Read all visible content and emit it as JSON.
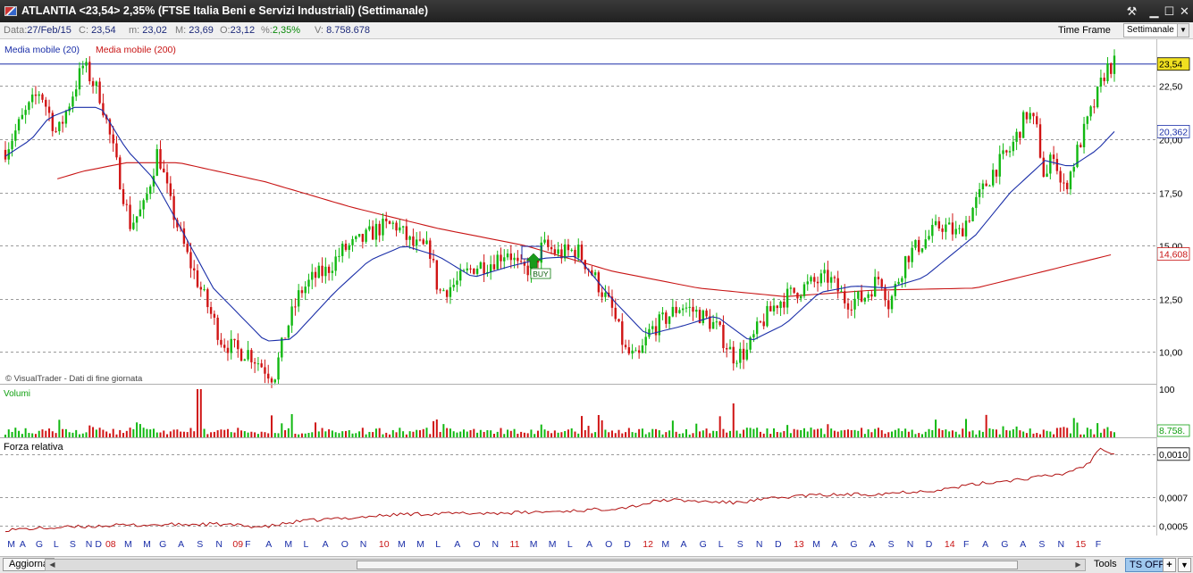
{
  "window": {
    "title": "ATLANTIA <23,54> 2,35%  (FTSE Italia Beni e Servizi Industriali)  (Settimanale)"
  },
  "info": {
    "date_label": "Data:",
    "date": "27/Feb/15",
    "close_label": "C:",
    "close": "23,54",
    "min_label": "m:",
    "min": "23,02",
    "max_label": "M:",
    "max": "23,69",
    "open_label": "O:",
    "open": "23,12",
    "pct_label": "%:",
    "pct": "2,35%",
    "vol_label": "V:",
    "vol": "8.758.678"
  },
  "timeframe": {
    "label": "Time Frame",
    "value": "Settimanale"
  },
  "legend": {
    "ma20": "Media mobile (20)",
    "ma200": "Media mobile (200)"
  },
  "copyright": "© VisualTrader - Dati di fine giornata",
  "panels": {
    "volume_title": "Volumi",
    "rs_title": "Forza relativa"
  },
  "signal": {
    "label": "BUY"
  },
  "colors": {
    "up": "#11b811",
    "down": "#d01414",
    "ma20": "#1a2ea8",
    "ma200": "#c81414",
    "grid": "#9a9a9a",
    "accent_box": "#f0e020"
  },
  "status": {
    "aggiorna": "Aggiorna",
    "tools": "Tools",
    "ts": "TS OFF",
    "plus": "+"
  },
  "chart_data": {
    "type": "candlestick",
    "title": "ATLANTIA <23,54> 2,35%",
    "price_axis": {
      "range": [
        8.5,
        24
      ],
      "ticks": [
        "10,00",
        "12,50",
        "15,00",
        "17,50",
        "20,00",
        "22,50"
      ],
      "tick_values": [
        10,
        12.5,
        15,
        17.5,
        20,
        22.5
      ]
    },
    "markers": [
      {
        "label": "23,54",
        "value": 23.54,
        "bg": "#f0e020",
        "fg": "#000000"
      },
      {
        "label": "20,362",
        "value": 20.362,
        "bg": "#ffffff",
        "fg": "#1a2ea8"
      },
      {
        "label": "14,608",
        "value": 14.608,
        "bg": "#ffffff",
        "fg": "#c81414"
      }
    ],
    "x_labels": [
      "M",
      "A",
      "G",
      "L",
      "S",
      "N",
      "D",
      "08",
      "M",
      "M",
      "G",
      "A",
      "S",
      "N",
      "09",
      "F",
      "A",
      "M",
      "L",
      "A",
      "O",
      "N",
      "10",
      "M",
      "M",
      "L",
      "A",
      "O",
      "N",
      "11",
      "M",
      "M",
      "L",
      "A",
      "O",
      "D",
      "12",
      "M",
      "A",
      "G",
      "L",
      "S",
      "N",
      "D",
      "13",
      "M",
      "A",
      "G",
      "A",
      "S",
      "N",
      "D",
      "14",
      "F",
      "A",
      "G",
      "A",
      "S",
      "N",
      "15",
      "F"
    ],
    "x_label_positions": [
      0.004,
      0.017,
      0.034,
      0.053,
      0.07,
      0.087,
      0.097,
      0.108,
      0.128,
      0.148,
      0.165,
      0.185,
      0.205,
      0.225,
      0.243,
      0.256,
      0.278,
      0.298,
      0.318,
      0.338,
      0.358,
      0.378,
      0.398,
      0.418,
      0.438,
      0.458,
      0.478,
      0.498,
      0.518,
      0.537,
      0.558,
      0.578,
      0.598,
      0.618,
      0.638,
      0.658,
      0.678,
      0.698,
      0.718,
      0.738,
      0.758,
      0.778,
      0.798,
      0.818,
      0.838,
      0.858,
      0.878,
      0.898,
      0.918,
      0.938,
      0.958,
      0.978,
      0.998,
      1.018,
      1.038,
      1.058,
      1.078,
      1.098,
      1.118,
      1.137,
      1.158
    ],
    "series_keypoints": [
      [
        0,
        19.5
      ],
      [
        10,
        21.0
      ],
      [
        20,
        22.3
      ],
      [
        30,
        20.2
      ],
      [
        40,
        22.4
      ],
      [
        45,
        23.5
      ],
      [
        55,
        22.0
      ],
      [
        65,
        18.5
      ],
      [
        72,
        16.0
      ],
      [
        80,
        16.8
      ],
      [
        88,
        19.5
      ],
      [
        95,
        17.0
      ],
      [
        105,
        14.5
      ],
      [
        115,
        12.5
      ],
      [
        125,
        10.5
      ],
      [
        135,
        10.0
      ],
      [
        140,
        10.0
      ],
      [
        150,
        9.2
      ],
      [
        155,
        8.8
      ],
      [
        162,
        11.0
      ],
      [
        170,
        12.8
      ],
      [
        178,
        13.5
      ],
      [
        185,
        13.8
      ],
      [
        195,
        14.8
      ],
      [
        205,
        15.2
      ],
      [
        215,
        15.8
      ],
      [
        225,
        16.0
      ],
      [
        235,
        15.0
      ],
      [
        245,
        14.8
      ],
      [
        250,
        12.8
      ],
      [
        260,
        13.2
      ],
      [
        270,
        14.0
      ],
      [
        280,
        14.2
      ],
      [
        290,
        14.8
      ],
      [
        297,
        13.8
      ],
      [
        305,
        14.0
      ],
      [
        310,
        15.0
      ],
      [
        320,
        14.6
      ],
      [
        330,
        14.8
      ],
      [
        340,
        13.5
      ],
      [
        350,
        12.0
      ],
      [
        358,
        10.0
      ],
      [
        365,
        9.6
      ],
      [
        372,
        11.0
      ],
      [
        380,
        11.5
      ],
      [
        390,
        12.2
      ],
      [
        400,
        11.8
      ],
      [
        410,
        11.2
      ],
      [
        420,
        9.8
      ],
      [
        428,
        10.0
      ],
      [
        435,
        11.2
      ],
      [
        445,
        12.3
      ],
      [
        455,
        12.8
      ],
      [
        465,
        13.2
      ],
      [
        475,
        13.5
      ],
      [
        485,
        12.4
      ],
      [
        495,
        12.5
      ],
      [
        505,
        13.6
      ],
      [
        510,
        12.2
      ],
      [
        520,
        14.5
      ],
      [
        530,
        15.2
      ],
      [
        540,
        16.0
      ],
      [
        550,
        15.5
      ],
      [
        560,
        17.0
      ],
      [
        570,
        18.5
      ],
      [
        580,
        19.5
      ],
      [
        590,
        21.3
      ],
      [
        595,
        20.5
      ],
      [
        600,
        18.0
      ],
      [
        605,
        19.5
      ],
      [
        610,
        17.5
      ],
      [
        615,
        18.5
      ],
      [
        620,
        19.8
      ],
      [
        630,
        22.0
      ],
      [
        635,
        23.3
      ],
      [
        640,
        23.54
      ]
    ],
    "ma200_keypoints": [
      [
        0,
        17.0
      ],
      [
        20,
        17.9
      ],
      [
        45,
        18.5
      ],
      [
        70,
        18.9
      ],
      [
        100,
        18.9
      ],
      [
        150,
        18.0
      ],
      [
        200,
        16.8
      ],
      [
        250,
        15.8
      ],
      [
        300,
        15.0
      ],
      [
        350,
        13.8
      ],
      [
        400,
        13.0
      ],
      [
        450,
        12.6
      ],
      [
        500,
        12.9
      ],
      [
        560,
        13.0
      ],
      [
        600,
        13.8
      ],
      [
        640,
        14.608
      ]
    ],
    "ma20_keypoints": [
      [
        0,
        19.2
      ],
      [
        15,
        20.0
      ],
      [
        25,
        21.0
      ],
      [
        40,
        21.5
      ],
      [
        55,
        21.5
      ],
      [
        70,
        19.5
      ],
      [
        85,
        18.2
      ],
      [
        100,
        16.0
      ],
      [
        120,
        13.0
      ],
      [
        150,
        10.5
      ],
      [
        165,
        10.6
      ],
      [
        190,
        12.8
      ],
      [
        210,
        14.3
      ],
      [
        230,
        15.0
      ],
      [
        250,
        14.5
      ],
      [
        270,
        13.5
      ],
      [
        290,
        14.0
      ],
      [
        310,
        14.4
      ],
      [
        330,
        14.5
      ],
      [
        350,
        12.5
      ],
      [
        370,
        10.8
      ],
      [
        390,
        11.2
      ],
      [
        410,
        11.7
      ],
      [
        430,
        10.5
      ],
      [
        450,
        11.3
      ],
      [
        470,
        12.8
      ],
      [
        490,
        13.1
      ],
      [
        510,
        13.0
      ],
      [
        530,
        13.5
      ],
      [
        560,
        15.5
      ],
      [
        580,
        17.5
      ],
      [
        600,
        19.0
      ],
      [
        615,
        18.7
      ],
      [
        630,
        19.5
      ],
      [
        640,
        20.362
      ]
    ],
    "volume_axis": {
      "ticks": [
        "100"
      ],
      "marker": "8.758."
    },
    "rs_axis": {
      "ticks": [
        "0,0010",
        "0,0007",
        "0,0005"
      ],
      "tick_values": [
        0.001,
        0.0007,
        0.0005
      ],
      "marker": "0,0010"
    }
  }
}
